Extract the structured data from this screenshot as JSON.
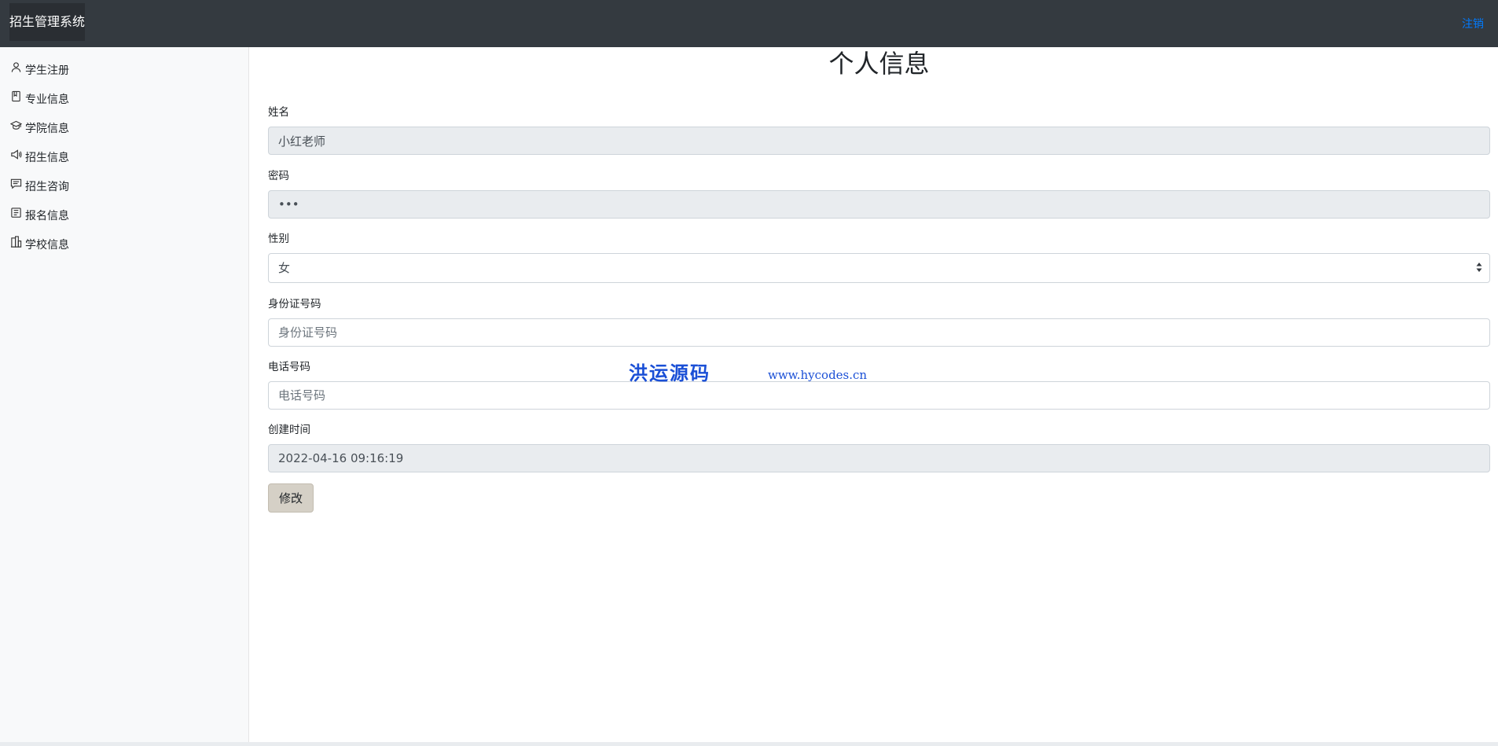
{
  "header": {
    "brand": "招生管理系统",
    "logout_label": "注销"
  },
  "sidebar": {
    "items": [
      {
        "label": "学生注册",
        "icon": "person-icon"
      },
      {
        "label": "专业信息",
        "icon": "book-icon"
      },
      {
        "label": "学院信息",
        "icon": "mortarboard-icon"
      },
      {
        "label": "招生信息",
        "icon": "megaphone-icon"
      },
      {
        "label": "招生咨询",
        "icon": "chat-icon"
      },
      {
        "label": "报名信息",
        "icon": "receipt-icon"
      },
      {
        "label": "学校信息",
        "icon": "building-icon"
      }
    ]
  },
  "main": {
    "title": "个人信息",
    "fields": {
      "name": {
        "label": "姓名",
        "value": "小红老师"
      },
      "password": {
        "label": "密码",
        "value": "•••"
      },
      "gender": {
        "label": "性别",
        "value": "女"
      },
      "id_number": {
        "label": "身份证号码",
        "placeholder": "身份证号码"
      },
      "phone": {
        "label": "电话号码",
        "placeholder": "电话号码"
      },
      "created": {
        "label": "创建时间",
        "value": "2022-04-16 09:16:19"
      }
    },
    "edit_button": "修改"
  },
  "watermark": {
    "text": "洪运源码",
    "url": "www.hycodes.cn"
  },
  "colors": {
    "navbar": "#343a40",
    "link": "#007bff",
    "sidebar": "#f8f9fa",
    "readonly": "#e9ecef",
    "watermark": "#1a4fd6"
  }
}
